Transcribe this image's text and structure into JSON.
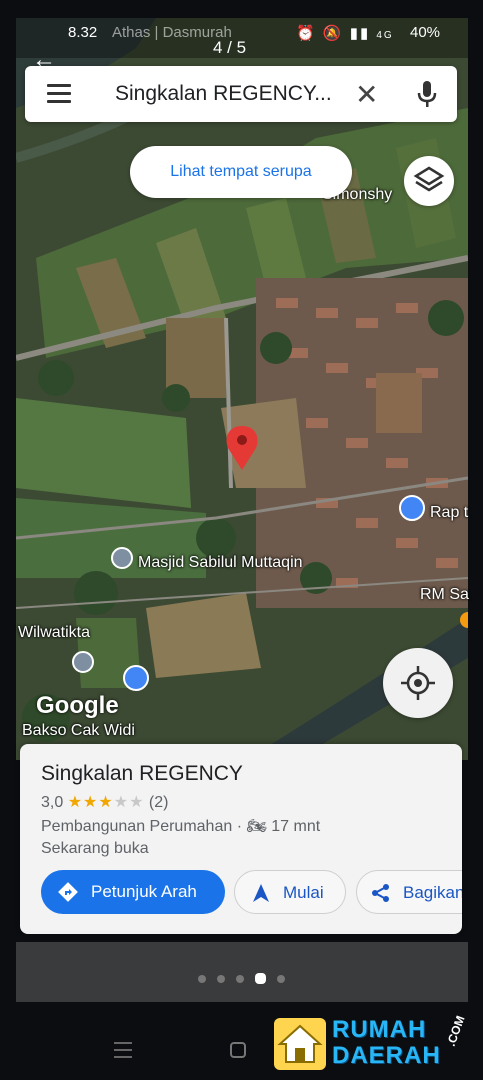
{
  "status": {
    "time": "8.32",
    "app_text": "Athas | Dasmurah",
    "counter": "4 / 5",
    "signal": "4G",
    "battery": "40%"
  },
  "search": {
    "query": "Singkalan REGENCY...",
    "clear": "✕"
  },
  "chip": {
    "label": "Lihat tempat serupa"
  },
  "map_labels": {
    "simonshy": "Simonshy",
    "rap": "Rap t",
    "masjid": "Masjid Sabilul Muttaqin",
    "rm": "RM Sa",
    "wilwatikta": "Wilwatikta",
    "bakso": "Bakso Cak Widi",
    "google": "Google"
  },
  "place": {
    "name": "Singkalan REGENCY",
    "rating": "3,0",
    "stars": "★★★",
    "stars_off": "★★",
    "reviews": "(2)",
    "category": "Pembangunan Perumahan",
    "travel": "17 mnt",
    "open": "Sekarang buka"
  },
  "actions": {
    "directions": "Petunjuk Arah",
    "start": "Mulai",
    "share": "Bagikan"
  },
  "pager": {
    "total": 5,
    "active_index": 4
  },
  "watermark": {
    "line1": "RUMAH",
    "line2": "DAERAH",
    "domain": ".COM"
  },
  "colors": {
    "accent": "#1a73e8",
    "pin": "#e53935",
    "star": "#f2a600"
  }
}
